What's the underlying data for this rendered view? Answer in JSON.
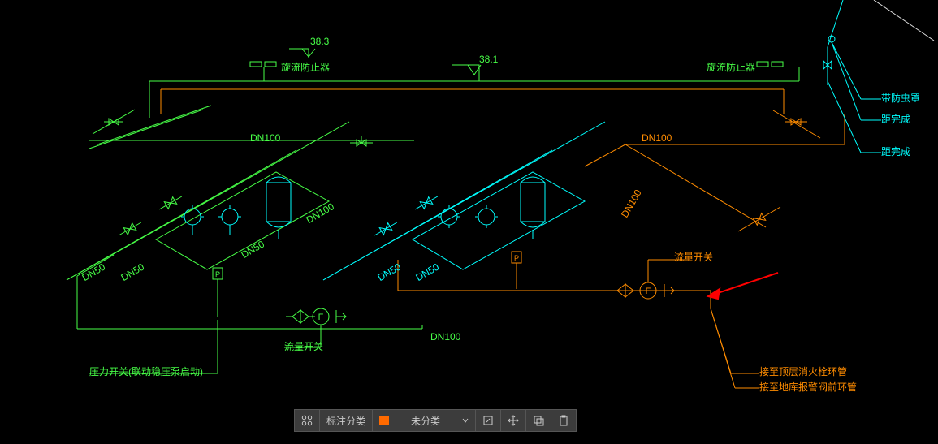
{
  "diagram": {
    "elev_left": "38.3",
    "elev_right": "38.1",
    "backflow_left": "旋流防止器",
    "backflow_right": "旋流防止器",
    "dn100_a": "DN100",
    "dn100_b": "DN100",
    "dn100_c": "DN100",
    "dn100_d": "DN100",
    "dn100_e": "DN100",
    "dn50_1": "DN50",
    "dn50_2": "DN50",
    "dn50_3": "DN50",
    "dn50_4": "DN50",
    "dn50_5": "DN50",
    "p_gauge_1": "P",
    "p_gauge_2": "P",
    "flow_switch_1": "流量开关",
    "flow_switch_2": "流量开关",
    "pressure_switch": "压力开关(联动稳压泵启动)",
    "to_top_hydrant": "接至顶层消火栓环管",
    "to_basement_alarm": "接至地库报警阀前环管",
    "insect_cover": "带防虫罩",
    "dist_a": "距完成",
    "dist_b": "距完成"
  },
  "toolbar": {
    "label_category": "标注分类",
    "dropdown_value": "未分类"
  },
  "colors": {
    "green": "#47ff47",
    "cyan": "#00ffff",
    "orange": "#ff8c00",
    "red": "#ff0000",
    "toolbar_swatch": "#ff6a00"
  }
}
